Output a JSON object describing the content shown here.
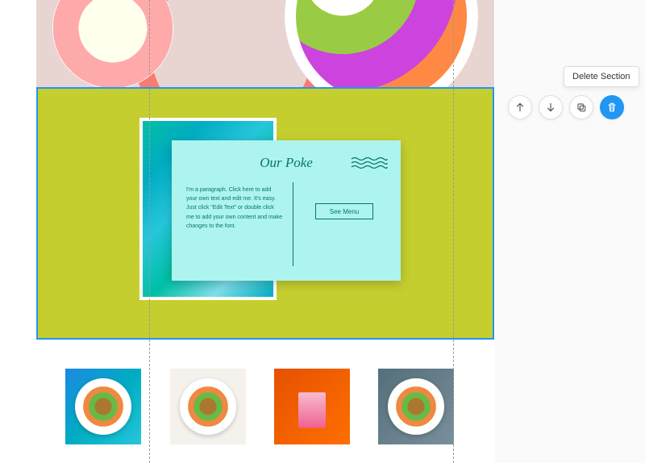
{
  "postcard": {
    "title": "Our Poke",
    "paragraph": "I'm a paragraph. Click here to add your own text and edit me. It's easy. Just click \"Edit Text\" or double click me to add your own content and make changes to the font.",
    "button_label": "See Menu"
  },
  "tooltip": {
    "delete_section": "Delete Section"
  },
  "colors": {
    "section_bg": "#c5ce2f",
    "postcard_bg": "#aef4ee",
    "accent_blue": "#2196F3",
    "teal_text": "#05766e"
  },
  "gallery": {
    "alt1": "Poke bowl on turquoise wood",
    "alt2": "Poke bowl with greens",
    "alt3": "Pink candle on orange stripes",
    "alt4": "Poke bowl with chopsticks"
  }
}
